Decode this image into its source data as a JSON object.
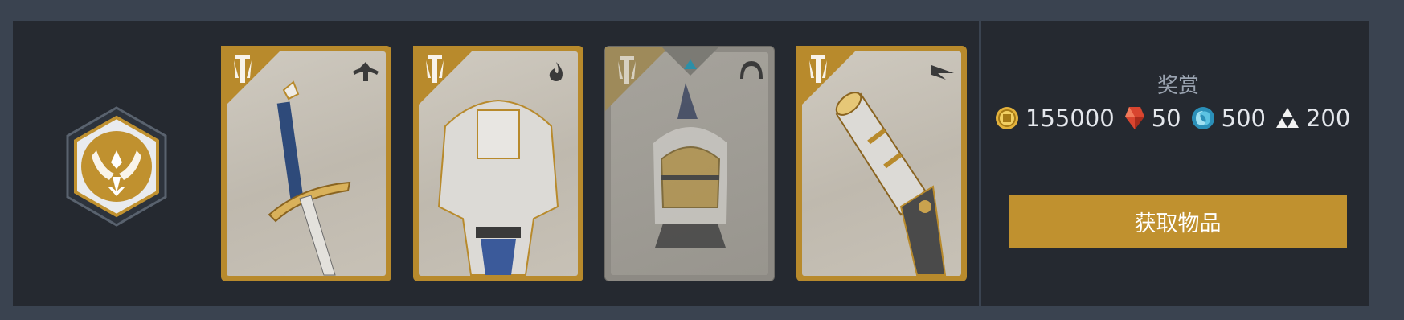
{
  "colors": {
    "gold": "#c0912f",
    "panel": "#252930",
    "backdrop": "#3a4350",
    "text": "#e4e7ec"
  },
  "emblem": {
    "icon": "winged-crest-icon"
  },
  "items": [
    {
      "type_icon": "sword-type-icon",
      "state": "available",
      "item": "greatsword"
    },
    {
      "type_icon": "flame-type-icon",
      "state": "available",
      "item": "plate-armor"
    },
    {
      "type_icon": "helm-type-icon",
      "state": "owned",
      "item": "winged-helmet",
      "marker_icon": "triangle-marker-icon"
    },
    {
      "type_icon": "bird-type-icon",
      "state": "available",
      "item": "gauntlet"
    }
  ],
  "rewards": {
    "title": "奖赏",
    "currencies": [
      {
        "icon": "coin-icon",
        "amount": "155000"
      },
      {
        "icon": "red-gem-icon",
        "amount": "50"
      },
      {
        "icon": "blue-orb-icon",
        "amount": "500"
      },
      {
        "icon": "triforce-icon",
        "amount": "200"
      }
    ]
  },
  "action": {
    "label": "获取物品"
  }
}
